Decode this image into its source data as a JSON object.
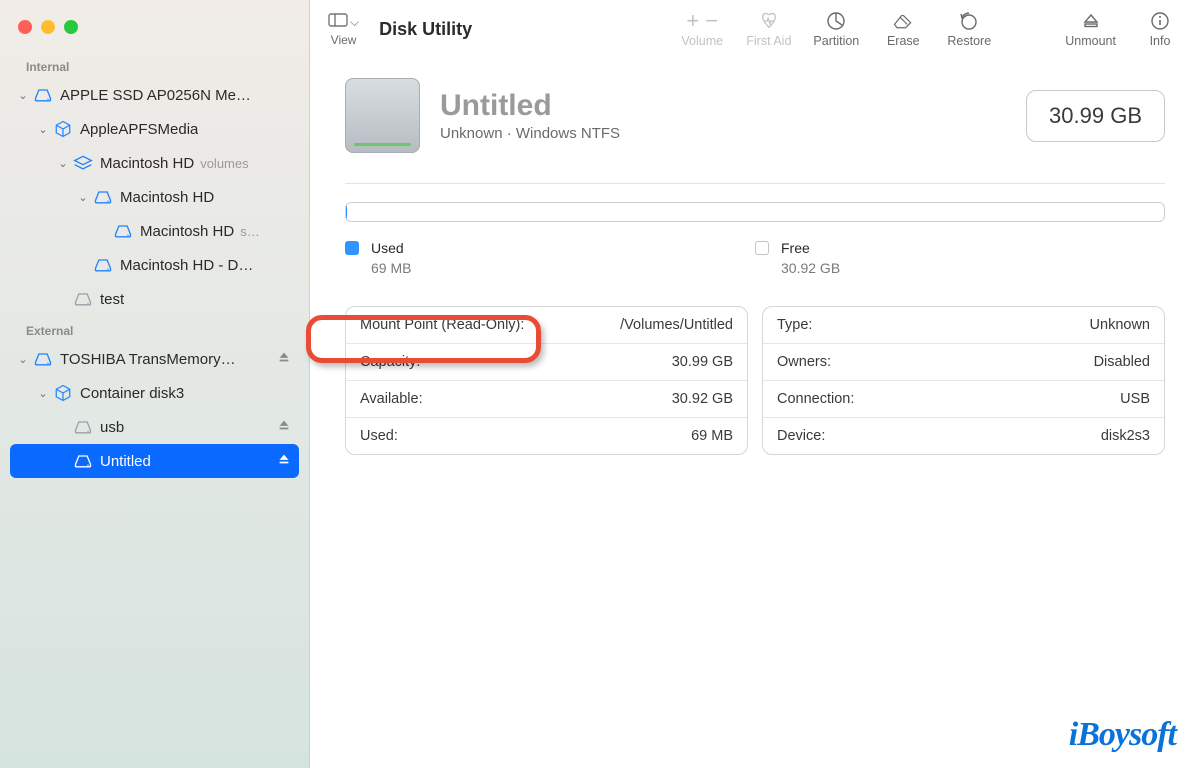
{
  "app": {
    "title": "Disk Utility"
  },
  "toolbar": {
    "view": "View",
    "items": [
      {
        "label": "Volume",
        "disabled": true
      },
      {
        "label": "First Aid",
        "disabled": true
      },
      {
        "label": "Partition",
        "disabled": false
      },
      {
        "label": "Erase",
        "disabled": false
      },
      {
        "label": "Restore",
        "disabled": false
      },
      {
        "label": "Unmount",
        "disabled": false
      },
      {
        "label": "Info",
        "disabled": false
      }
    ]
  },
  "sidebar": {
    "sections": [
      {
        "title": "Internal",
        "items": [
          {
            "depth": 0,
            "chev": true,
            "icon": "disk",
            "color": "#1e83ff",
            "label": "APPLE SSD AP0256N Me…"
          },
          {
            "depth": 1,
            "chev": true,
            "icon": "cube",
            "color": "#1e83ff",
            "label": "AppleAPFSMedia"
          },
          {
            "depth": 2,
            "chev": true,
            "icon": "layers",
            "color": "#1e83ff",
            "label": "Macintosh HD",
            "suffix": "volumes"
          },
          {
            "depth": 3,
            "chev": true,
            "icon": "disk",
            "color": "#1e83ff",
            "label": "Macintosh HD"
          },
          {
            "depth": 4,
            "chev": false,
            "icon": "disk",
            "color": "#1e83ff",
            "label": "Macintosh HD",
            "suffix": "s…"
          },
          {
            "depth": 3,
            "chev": false,
            "icon": "disk",
            "color": "#1e83ff",
            "label": "Macintosh HD - D…"
          },
          {
            "depth": 2,
            "chev": false,
            "icon": "disk",
            "color": "#9aa0a6",
            "label": "test"
          }
        ]
      },
      {
        "title": "External",
        "items": [
          {
            "depth": 0,
            "chev": true,
            "icon": "disk",
            "color": "#1e83ff",
            "label": "TOSHIBA TransMemory…",
            "eject": true
          },
          {
            "depth": 1,
            "chev": true,
            "icon": "cube",
            "color": "#1e83ff",
            "label": "Container disk3"
          },
          {
            "depth": 2,
            "chev": false,
            "icon": "disk",
            "color": "#9aa0a6",
            "label": "usb",
            "eject": true
          },
          {
            "depth": 2,
            "chev": false,
            "icon": "disk",
            "color": "#ffffff",
            "label": "Untitled",
            "eject": true,
            "selected": true
          }
        ]
      }
    ]
  },
  "volume": {
    "name": "Untitled",
    "subtitle": "Unknown · Windows NTFS",
    "size": "30.99 GB",
    "usage": {
      "used_label": "Used",
      "used_value": "69 MB",
      "free_label": "Free",
      "free_value": "30.92 GB"
    },
    "left_rows": [
      {
        "k": "Mount Point (Read-Only):",
        "v": "/Volumes/Untitled"
      },
      {
        "k": "Capacity:",
        "v": "30.99 GB"
      },
      {
        "k": "Available:",
        "v": "30.92 GB"
      },
      {
        "k": "Used:",
        "v": "69 MB"
      }
    ],
    "right_rows": [
      {
        "k": "Type:",
        "v": "Unknown"
      },
      {
        "k": "Owners:",
        "v": "Disabled"
      },
      {
        "k": "Connection:",
        "v": "USB"
      },
      {
        "k": "Device:",
        "v": "disk2s3"
      }
    ]
  },
  "watermark": "iBoysoft"
}
